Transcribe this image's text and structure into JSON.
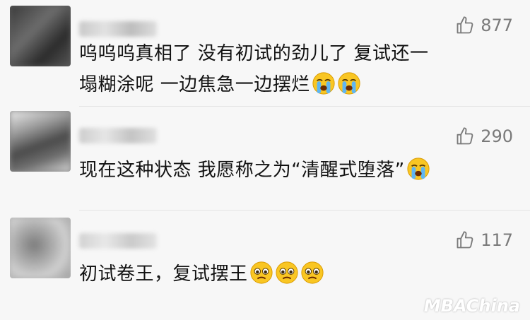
{
  "comments": [
    {
      "likes": "877",
      "line1": "呜呜呜真相了  没有初试的劲儿了  复试还一",
      "line2": "塌糊涂呢  一边焦急一边摆烂",
      "emoji": [
        "crying-face",
        "crying-face"
      ]
    },
    {
      "likes": "290",
      "line1": "现在这种状态  我愿称之为“清醒式堕落”",
      "emoji": [
        "crying-face"
      ]
    },
    {
      "likes": "117",
      "line1": "初试卷王，复试摆王",
      "emoji": [
        "pleading-face",
        "pleading-face",
        "pleading-face"
      ]
    }
  ],
  "watermark": "MBAChina",
  "colors": {
    "background": "#f7f7f7",
    "text": "#121212",
    "like": "#7a7a7a"
  }
}
